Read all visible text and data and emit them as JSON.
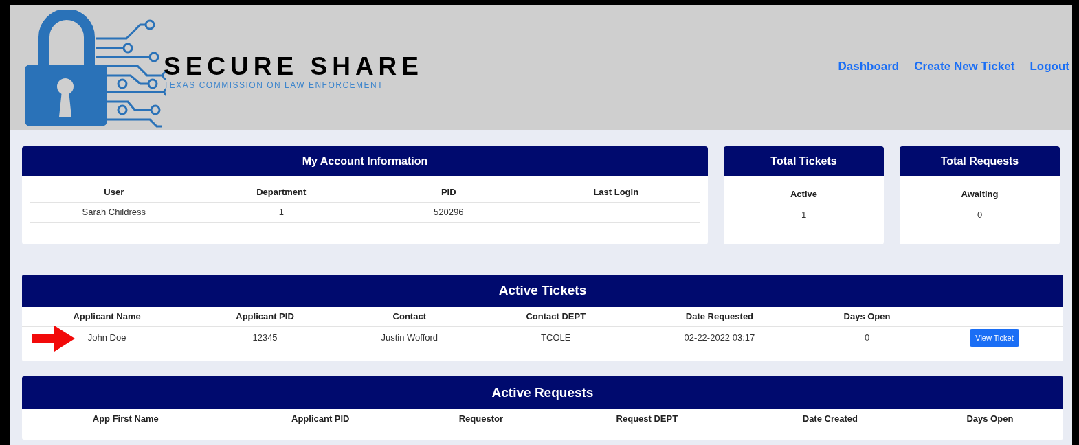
{
  "header": {
    "brand": "SECURE SHARE",
    "tagline": "TEXAS COMMISSION ON LAW ENFORCEMENT",
    "nav": [
      "Dashboard",
      "Create New Ticket",
      "Logout"
    ]
  },
  "account": {
    "title": "My Account Information",
    "columns": [
      "User",
      "Department",
      "PID",
      "Last Login"
    ],
    "rows": [
      [
        "Sarah Childress",
        "1",
        "520296",
        ""
      ]
    ]
  },
  "summaries": [
    {
      "title": "Total Tickets",
      "label": "Active",
      "value": "1"
    },
    {
      "title": "Total Requests",
      "label": "Awaiting",
      "value": "0"
    }
  ],
  "active_tickets": {
    "title": "Active Tickets",
    "columns": [
      "Applicant Name",
      "Applicant PID",
      "Contact",
      "Contact DEPT",
      "Date Requested",
      "Days Open"
    ],
    "rows": [
      {
        "cells": [
          "John Doe",
          "12345",
          "Justin Wofford",
          "TCOLE",
          "02-22-2022 03:17",
          "0"
        ],
        "action": "View Ticket"
      }
    ]
  },
  "active_requests": {
    "title": "Active Requests",
    "columns": [
      "App First Name",
      "Applicant PID",
      "Requestor",
      "Request DEPT",
      "Date Created",
      "Days Open"
    ]
  }
}
